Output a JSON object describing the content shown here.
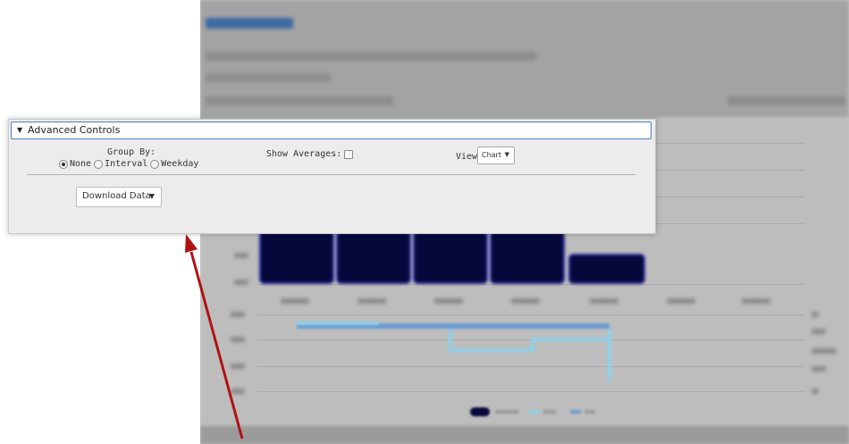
{
  "advanced_controls": {
    "toggle_glyph": "▼",
    "title": "Advanced Controls",
    "group_by": {
      "label": "Group By:",
      "options": [
        {
          "label": "None",
          "checked": true
        },
        {
          "label": "Interval",
          "checked": false
        },
        {
          "label": "Weekday",
          "checked": false
        }
      ]
    },
    "show_averages": {
      "label": "Show Averages:",
      "checked": false
    },
    "view": {
      "label": "View:",
      "selected": "Chart",
      "caret": "▼"
    },
    "download": {
      "selected": "Download Data",
      "caret": "▼"
    }
  },
  "annotation": {
    "arrow_color": "#b01212"
  },
  "colors": {
    "panel_header_border": "#4a7fc1",
    "chart_bar": "#06073a",
    "series_light": "#8fd0ea",
    "series_mid": "#6a9bd1"
  }
}
